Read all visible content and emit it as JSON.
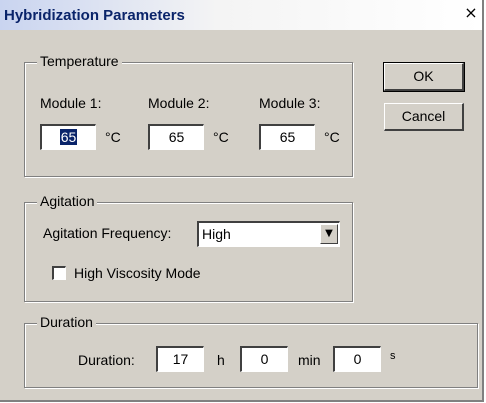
{
  "window": {
    "title": "Hybridization Parameters",
    "close_glyph": "×"
  },
  "buttons": {
    "ok": "OK",
    "cancel": "Cancel"
  },
  "temperature": {
    "legend": "Temperature",
    "unit": "°C",
    "modules": [
      {
        "label": "Module 1:",
        "value": "65"
      },
      {
        "label": "Module 2:",
        "value": "65"
      },
      {
        "label": "Module 3:",
        "value": "65"
      }
    ]
  },
  "agitation": {
    "legend": "Agitation",
    "frequency_label": "Agitation Frequency:",
    "frequency_value": "High",
    "high_viscosity_label": "High Viscosity Mode",
    "high_viscosity_checked": false
  },
  "duration": {
    "legend": "Duration",
    "label": "Duration:",
    "hours": "17",
    "hours_unit": "h",
    "minutes": "0",
    "minutes_unit": "min",
    "seconds": "0",
    "seconds_unit": "s"
  }
}
